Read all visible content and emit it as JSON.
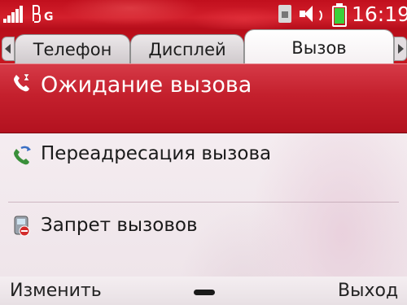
{
  "status_bar": {
    "network_type": "G",
    "clock": "16:19",
    "icons": [
      "signal-strength-icon",
      "network-3g-icon",
      "sim-card-icon",
      "speaker-icon",
      "battery-icon"
    ],
    "battery_color": "#3ad13a"
  },
  "tabs": [
    {
      "label": "Телефон",
      "active": false
    },
    {
      "label": "Дисплей",
      "active": false
    },
    {
      "label": "Вызов",
      "active": true
    }
  ],
  "list": {
    "items": [
      {
        "label": "Ожидание вызова",
        "icon": "call-waiting-icon",
        "selected": true
      },
      {
        "label": "Переадресация вызова",
        "icon": "call-forwarding-icon",
        "selected": false
      },
      {
        "label": "Запрет вызовов",
        "icon": "call-barring-icon",
        "selected": false
      }
    ]
  },
  "softkeys": {
    "left": "Изменить",
    "right": "Выход"
  },
  "colors": {
    "accent": "#c4202d",
    "background": "#f2e9ec"
  }
}
